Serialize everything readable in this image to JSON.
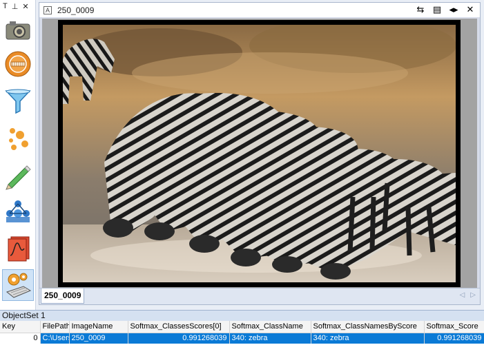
{
  "toolbar": {
    "header": [
      "T",
      "⊥",
      "✕"
    ],
    "tools": [
      {
        "name": "camera-tool",
        "icon": "camera-icon"
      },
      {
        "name": "meter-tool",
        "icon": "gauge-icon"
      },
      {
        "name": "filter-tool",
        "icon": "funnel-icon"
      },
      {
        "name": "blobs-tool",
        "icon": "blobs-icon"
      },
      {
        "name": "pencil-tool",
        "icon": "pencil-icon"
      },
      {
        "name": "molecules-tool",
        "icon": "molecules-icon"
      },
      {
        "name": "signal-tool",
        "icon": "signal-icon"
      },
      {
        "name": "settings-tool",
        "icon": "gears-keyboard-icon"
      }
    ]
  },
  "document": {
    "title_badge": "A",
    "title": "250_0009",
    "controls": [
      "⇆",
      "▤",
      "◂▸",
      "✕"
    ],
    "tab_label": "250_0009",
    "tab_arrows": [
      "◁",
      "▷"
    ]
  },
  "objectset": {
    "title": "ObjectSet 1",
    "columns": [
      "Key",
      "FilePath",
      "ImageName",
      "Softmax_ClassesScores[0]",
      "Softmax_ClassName",
      "Softmax_ClassNamesByScore",
      "Softmax_Score"
    ],
    "rows": [
      {
        "key": "0",
        "filepath": "C:\\Users",
        "imagename": "250_0009",
        "scores0": "0.991268039",
        "classname": "340: zebra",
        "namesbyscore": "340: zebra",
        "score": "0.991268039"
      }
    ]
  },
  "colors": {
    "selection": "#0a7ad6",
    "panel": "#d6dbe9",
    "accent": "#e98b26"
  }
}
